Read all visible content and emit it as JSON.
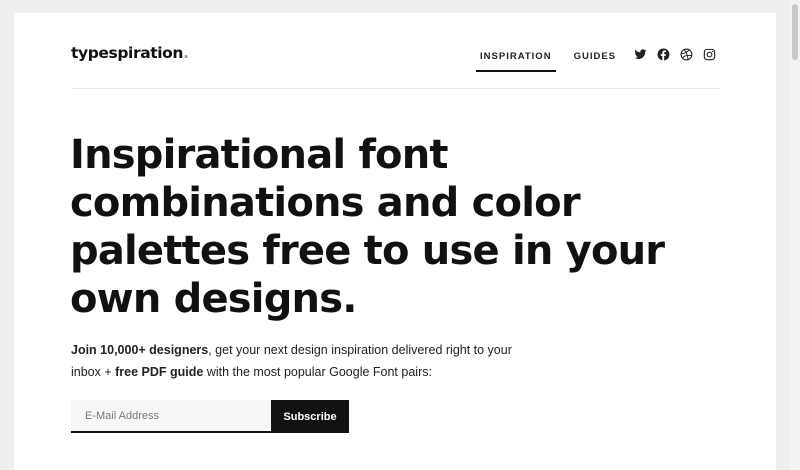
{
  "brand": {
    "logo_text": "typespiration",
    "logo_dot": "."
  },
  "nav": {
    "items": [
      {
        "label": "INSPIRATION",
        "active": true
      },
      {
        "label": "GUIDES",
        "active": false
      }
    ]
  },
  "social": {
    "icons": [
      "twitter-icon",
      "facebook-icon",
      "dribbble-icon",
      "instagram-icon"
    ]
  },
  "hero": {
    "headline": "Inspirational font combinations and color palettes free to use in your own designs.",
    "sub_bold_1": "Join 10,000+ designers",
    "sub_text_1": ", get your next design inspiration delivered right to your inbox + ",
    "sub_bold_2": "free PDF guide",
    "sub_text_2": " with the most popular Google Font pairs:"
  },
  "signup": {
    "email_placeholder": "E-Mail Address",
    "email_value": "",
    "button_label": "Subscribe"
  },
  "colors": {
    "page_bg": "#efefef",
    "card_bg": "#ffffff",
    "text": "#111111",
    "button_bg": "#111111",
    "input_bg": "#f7f7f7"
  }
}
